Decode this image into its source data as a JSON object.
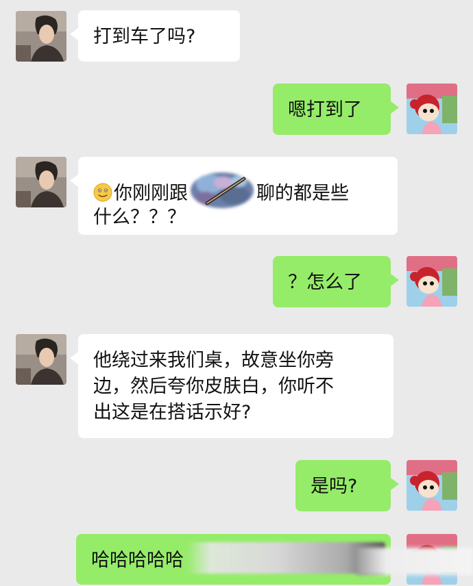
{
  "messages": [
    {
      "side": "in",
      "avatar": "man-avatar",
      "text": "打到车了吗?"
    },
    {
      "side": "out",
      "avatar": "girl-avatar",
      "text": "嗯打到了"
    },
    {
      "side": "in",
      "avatar": "man-avatar",
      "emoji": "smiling-face-emoji",
      "text_before": "你刚刚跟",
      "redacted": "redacted-name",
      "text_after_line1": "聊的都是些",
      "text_line2": "什么？？？"
    },
    {
      "side": "out",
      "avatar": "girl-avatar",
      "text": "？怎么了"
    },
    {
      "side": "in",
      "avatar": "man-avatar",
      "lines": [
        "他绕过来我们桌，故意坐你旁",
        "边，然后夸你皮肤白，你听不",
        "出这是在搭话示好?"
      ]
    },
    {
      "side": "out",
      "avatar": "girl-avatar",
      "text": "是吗?"
    },
    {
      "side": "out",
      "avatar": "girl-avatar",
      "text": "哈哈哈哈哈"
    }
  ],
  "colors": {
    "background": "#eaeaea",
    "incoming_bubble": "#ffffff",
    "outgoing_bubble": "#95ec69"
  }
}
